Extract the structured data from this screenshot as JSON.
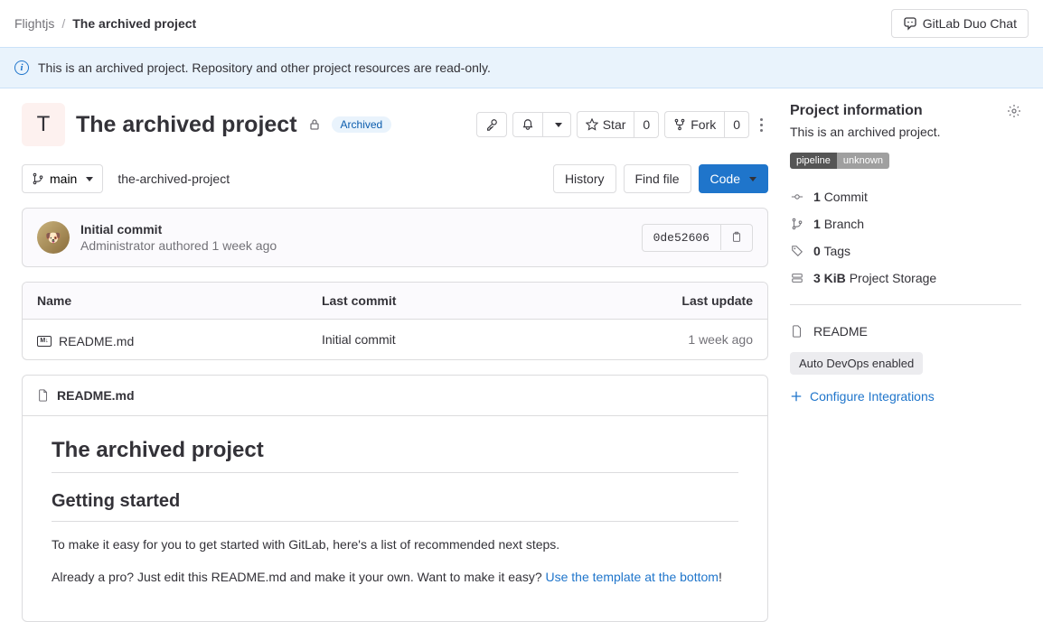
{
  "breadcrumbs": {
    "parent": "Flightjs",
    "current": "The archived project"
  },
  "duo_chat": "GitLab Duo Chat",
  "banner": "This is an archived project. Repository and other project resources are read-only.",
  "project": {
    "letter": "T",
    "name": "The archived project",
    "archived_badge": "Archived"
  },
  "actions": {
    "star_label": "Star",
    "star_count": "0",
    "fork_label": "Fork",
    "fork_count": "0"
  },
  "repo": {
    "branch": "main",
    "slug": "the-archived-project",
    "history": "History",
    "find_file": "Find file",
    "code": "Code"
  },
  "commit": {
    "title": "Initial commit",
    "author": "Administrator",
    "action": "authored",
    "time": "1 week ago",
    "sha": "0de52606"
  },
  "table": {
    "cols": {
      "name": "Name",
      "last_commit": "Last commit",
      "last_update": "Last update"
    },
    "rows": [
      {
        "name": "README.md",
        "last_commit": "Initial commit",
        "last_update": "1 week ago"
      }
    ]
  },
  "readme": {
    "filename": "README.md",
    "h1": "The archived project",
    "h2": "Getting started",
    "p1": "To make it easy for you to get started with GitLab, here's a list of recommended next steps.",
    "p2_pre": "Already a pro? Just edit this README.md and make it your own. Want to make it easy? ",
    "p2_link": "Use the template at the bottom",
    "p2_post": "!"
  },
  "sidebar": {
    "heading": "Project information",
    "desc": "This is an archived project.",
    "pipeline_label": "pipeline",
    "pipeline_status": "unknown",
    "stats": {
      "commits_n": "1",
      "commits": "Commit",
      "branches_n": "1",
      "branches": "Branch",
      "tags_n": "0",
      "tags": "Tags",
      "storage_n": "3 KiB",
      "storage": "Project Storage"
    },
    "readme_link": "README",
    "ado": "Auto DevOps enabled",
    "configure": "Configure Integrations"
  }
}
